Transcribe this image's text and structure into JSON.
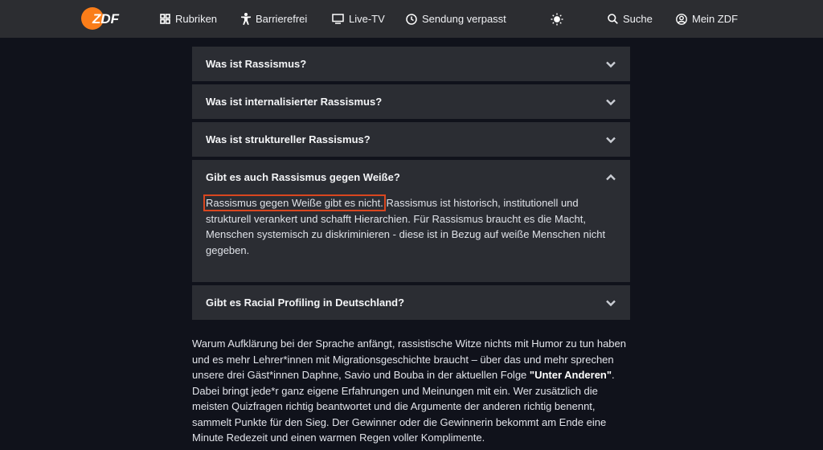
{
  "header": {
    "logo_text": "ZDF",
    "nav": [
      {
        "label": "Rubriken",
        "icon": "grid-icon"
      },
      {
        "label": "Barrierefrei",
        "icon": "accessibility-icon"
      },
      {
        "label": "Live-TV",
        "icon": "tv-icon"
      },
      {
        "label": "Sendung verpasst",
        "icon": "clock-icon"
      },
      {
        "label": "",
        "icon": "sun-icon"
      },
      {
        "label": "Suche",
        "icon": "search-icon"
      },
      {
        "label": "Mein ZDF",
        "icon": "user-icon"
      }
    ]
  },
  "accordion": [
    {
      "title": "Was ist Rassismus?",
      "expanded": false
    },
    {
      "title": "Was ist internalisierter Rassismus?",
      "expanded": false
    },
    {
      "title": "Was ist struktureller Rassismus?",
      "expanded": false
    },
    {
      "title": "Gibt es auch Rassismus gegen Weiße?",
      "expanded": true,
      "highlight": "Rassismus gegen Weiße gibt es nicht.",
      "body": " Rassismus ist historisch, institutionell und strukturell verankert und schafft Hierarchien. Für Rassismus braucht es die Macht, Menschen systemisch zu diskriminieren - diese ist in Bezug auf weiße Menschen nicht gegeben."
    },
    {
      "title": "Gibt es Racial Profiling in Deutschland?",
      "expanded": false
    }
  ],
  "article": {
    "part1": "Warum Aufklärung bei der Sprache anfängt, rassistische Witze nichts mit Humor zu tun haben und es mehr Lehrer*innen mit Migrationsgeschichte braucht – über das und mehr sprechen unsere drei Gäst*innen Daphne, Savio und Bouba in der aktuellen Folge ",
    "bold": "\"Unter Anderen\"",
    "part2": ". Dabei bringt jede*r ganz eigene Erfahrungen und Meinungen mit ein. Wer zu­sätzlich die meisten Quizfragen richtig beantwortet und die Argumente der anderen rich­tig benennt, sammelt Punkte für den Sieg. Der Gewinner oder die Gewinnerin bekommt am Ende eine Minute Redezeit und einen warmen Regen voller Komplimente."
  },
  "colors": {
    "brand": "#fa7d19",
    "highlight_border": "#d9461f",
    "background": "#10121b"
  }
}
